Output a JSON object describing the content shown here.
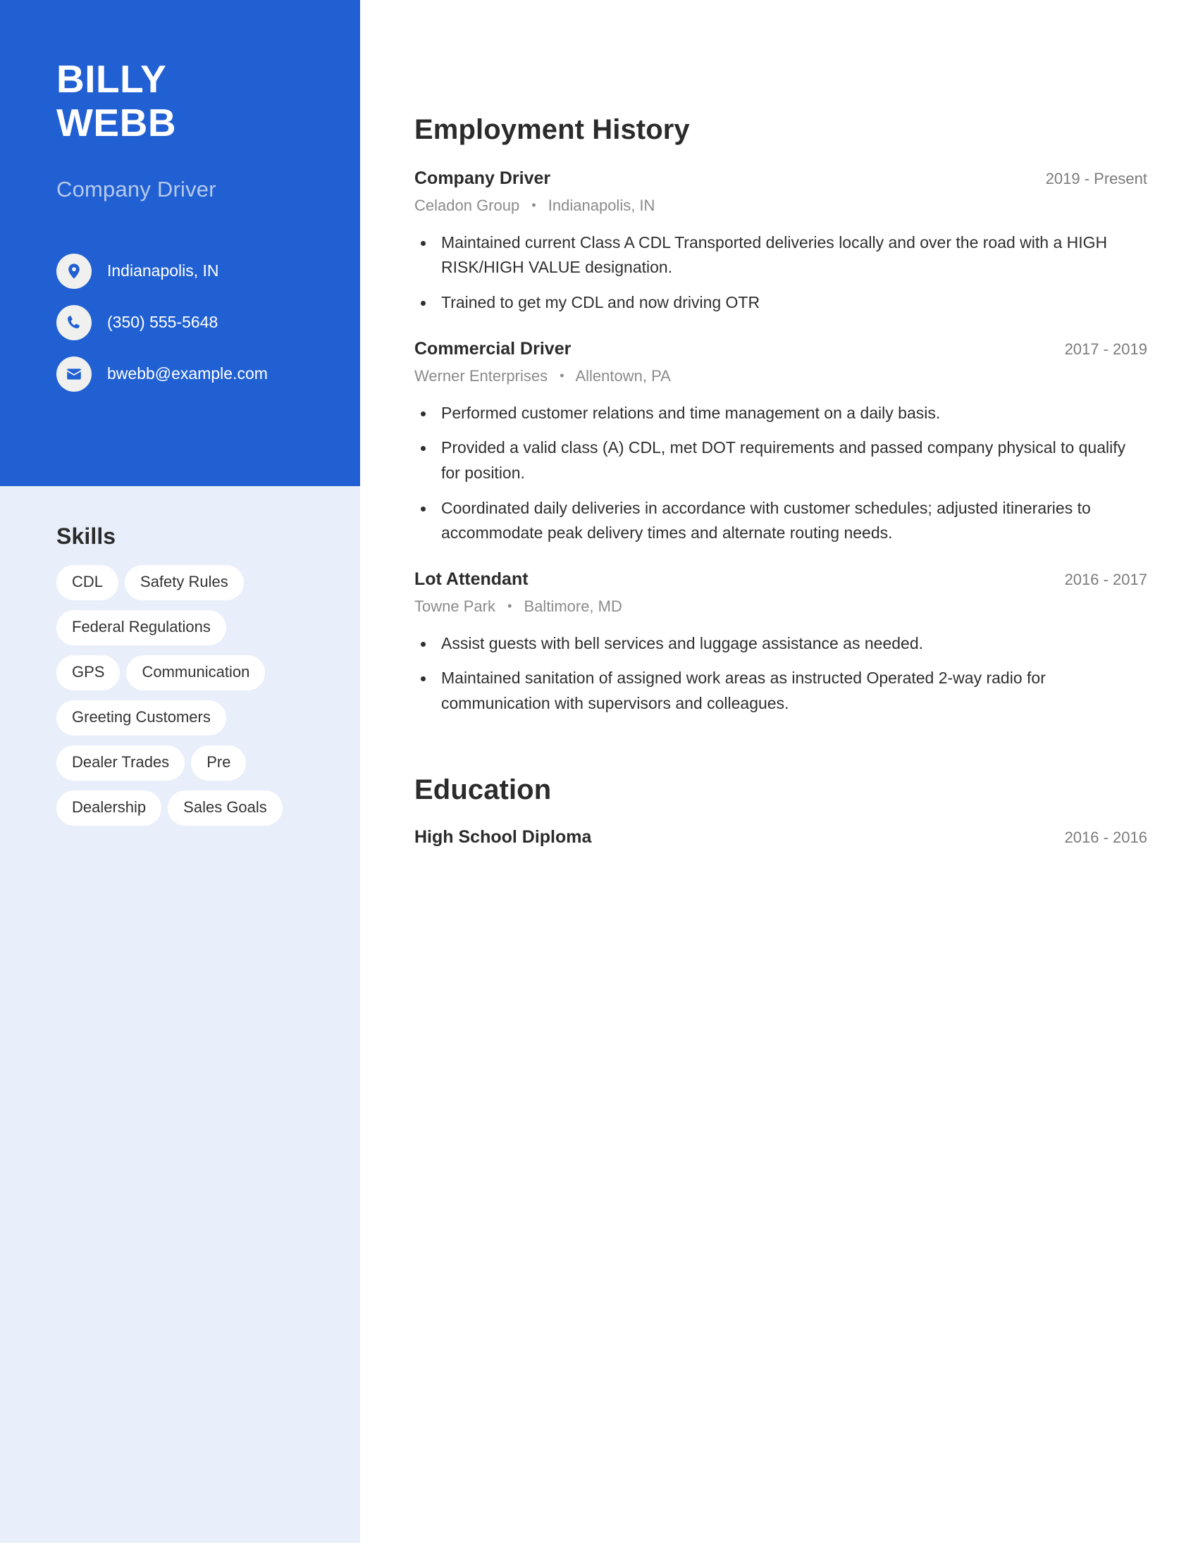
{
  "theme": {
    "accent_blue": "#2160d3",
    "sidebar_light": "#e8eefa",
    "tag_bg": "#ffffff",
    "heading_color": "#2b2b2b",
    "muted_text": "#8b8b8b",
    "subtitle_color": "#b5caee"
  },
  "sidebar": {
    "name_first": "BILLY",
    "name_last": "WEBB",
    "job_title": "Company Driver",
    "contacts": [
      {
        "icon": "location-pin-icon",
        "value": "Indianapolis, IN"
      },
      {
        "icon": "phone-icon",
        "value": "(350) 555-5648"
      },
      {
        "icon": "envelope-icon",
        "value": "bwebb@example.com"
      }
    ],
    "skills_heading": "Skills",
    "skills": [
      "CDL",
      "Safety Rules",
      "Federal Regulations",
      "GPS",
      "Communication",
      "Greeting Customers",
      "Dealer Trades",
      "Pre",
      "Dealership",
      "Sales Goals"
    ]
  },
  "main": {
    "employment_heading": "Employment History",
    "jobs": [
      {
        "title": "Company Driver",
        "dates": "2019 - Present",
        "company": "Celadon Group",
        "location": "Indianapolis, IN",
        "separator": "•",
        "bullets": [
          "Maintained current Class A CDL Transported deliveries locally and over the road with a HIGH RISK/HIGH VALUE designation.",
          "Trained to get my CDL and now driving OTR"
        ]
      },
      {
        "title": "Commercial Driver",
        "dates": "2017 - 2019",
        "company": "Werner Enterprises",
        "location": "Allentown, PA",
        "separator": "•",
        "bullets": [
          "Performed customer relations and time management on a daily basis.",
          "Provided a valid class (A) CDL, met DOT requirements and passed company physical to qualify for position.",
          "Coordinated daily deliveries in accordance with customer schedules; adjusted itineraries to accommodate peak delivery times and alternate routing needs."
        ]
      },
      {
        "title": "Lot Attendant",
        "dates": "2016 - 2017",
        "company": "Towne Park",
        "location": "Baltimore, MD",
        "separator": "•",
        "bullets": [
          "Assist guests with bell services and luggage assistance as needed.",
          "Maintained sanitation of assigned work areas as instructed Operated 2-way radio for communication with supervisors and colleagues."
        ]
      }
    ],
    "education_heading": "Education",
    "education": [
      {
        "degree": "High School Diploma",
        "dates": "2016 - 2016"
      }
    ]
  }
}
